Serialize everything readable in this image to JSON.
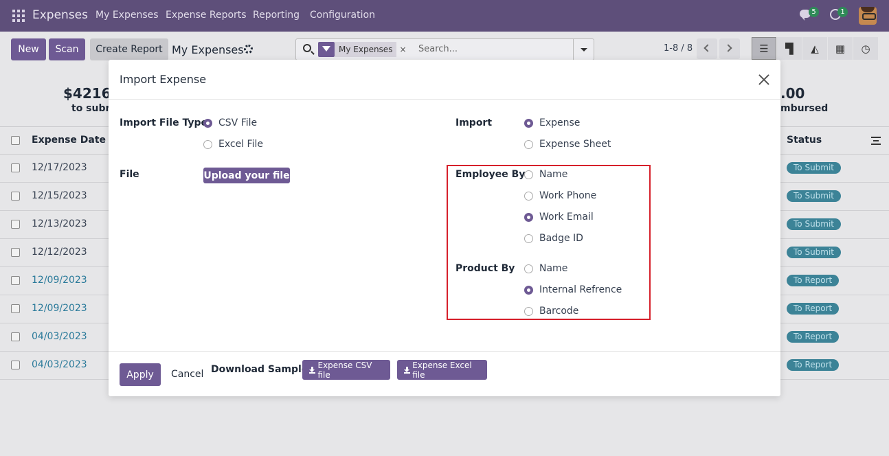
{
  "nav": {
    "app_name": "Expenses",
    "menu": [
      "My Expenses",
      "Expense Reports",
      "Reporting",
      "Configuration"
    ],
    "chat_count": "5",
    "activity_count": "1"
  },
  "control_panel": {
    "new_label": "New",
    "scan_label": "Scan",
    "create_report_label": "Create Report",
    "breadcrumb": "My Expenses",
    "facet_label": "My Expenses",
    "facet_close": "×",
    "search_placeholder": "Search...",
    "pager": "1-8 / 8"
  },
  "list": {
    "summary_left_amount": "$4216.",
    "summary_left_label": "to subm",
    "summary_right_amount": ".00",
    "summary_right_label": "mbursed",
    "col_date": "Expense Date",
    "col_status": "Status",
    "rows": [
      {
        "date": "12/17/2023",
        "status": "To Submit",
        "linked": false
      },
      {
        "date": "12/15/2023",
        "status": "To Submit",
        "linked": false
      },
      {
        "date": "12/13/2023",
        "status": "To Submit",
        "linked": false
      },
      {
        "date": "12/12/2023",
        "status": "To Submit",
        "linked": false
      },
      {
        "date": "12/09/2023",
        "status": "To Report",
        "linked": true
      },
      {
        "date": "12/09/2023",
        "status": "To Report",
        "linked": true
      },
      {
        "date": "04/03/2023",
        "status": "To Report",
        "linked": true
      },
      {
        "date": "04/03/2023",
        "status": "To Report",
        "linked": true
      }
    ]
  },
  "modal": {
    "title": "Import Expense",
    "import_file_type_label": "Import File Type",
    "csv_label": "CSV File",
    "excel_label": "Excel File",
    "file_label": "File",
    "upload_label": "Upload your file",
    "import_label": "Import",
    "expense_label": "Expense",
    "expense_sheet_label": "Expense Sheet",
    "employee_by_label": "Employee By",
    "emp_name": "Name",
    "emp_phone": "Work Phone",
    "emp_email": "Work Email",
    "emp_badge": "Badge ID",
    "product_by_label": "Product By",
    "prod_name": "Name",
    "prod_ref": "Internal Refrence",
    "prod_barcode": "Barcode",
    "apply_label": "Apply",
    "cancel_label": "Cancel",
    "download_sample_label": "Download Sample:",
    "csv_download_label": "Expense CSV file",
    "excel_download_label": "Expense Excel file"
  },
  "colors": {
    "primary": "#6e5a94",
    "navbar": "#5e4f7a",
    "highlight": "#d6202b",
    "status_badge": "#3c8397",
    "link_date": "#2a7a9a"
  }
}
